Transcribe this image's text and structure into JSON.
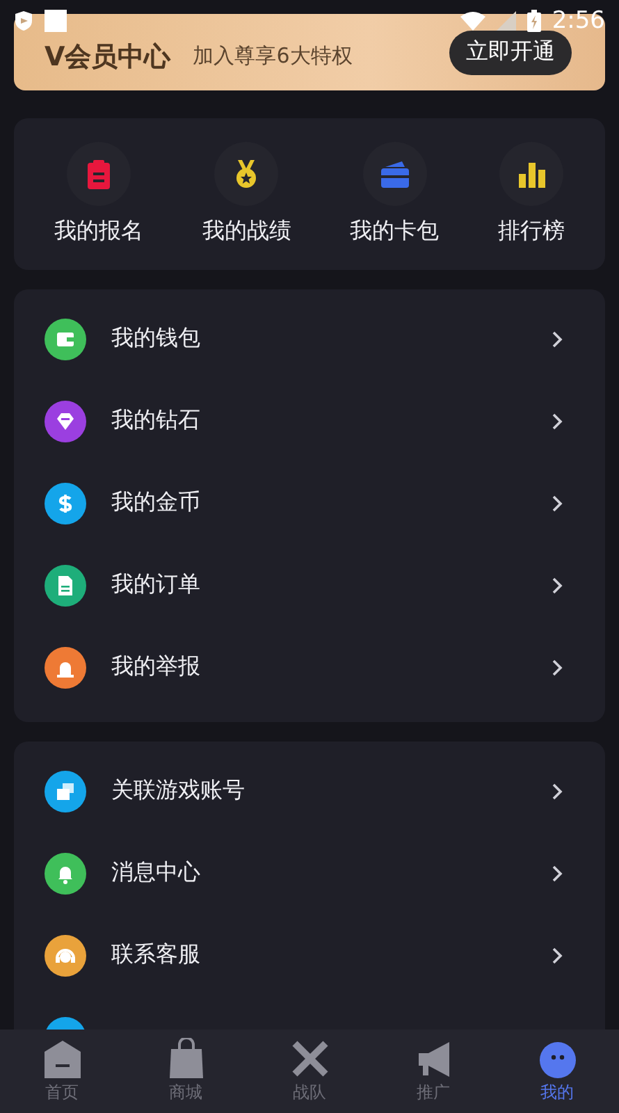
{
  "status_bar": {
    "time": "2:56"
  },
  "vip_banner": {
    "title": "V会员中心",
    "subtitle": "加入尊享6大特权",
    "button": "立即开通"
  },
  "shortcuts": [
    {
      "label": "我的报名"
    },
    {
      "label": "我的战绩"
    },
    {
      "label": "我的卡包"
    },
    {
      "label": "排行榜"
    }
  ],
  "menu_groups": [
    [
      {
        "label": "我的钱包",
        "color": "#3fbf5a"
      },
      {
        "label": "我的钻石",
        "color": "#9b3fe0"
      },
      {
        "label": "我的金币",
        "color": "#14a5ea"
      },
      {
        "label": "我的订单",
        "color": "#1eae7a"
      },
      {
        "label": "我的举报",
        "color": "#ee7a35"
      }
    ],
    [
      {
        "label": "关联游戏账号",
        "color": "#14a5ea"
      },
      {
        "label": "消息中心",
        "color": "#3fbf5a"
      },
      {
        "label": "联系客服",
        "color": "#e9a23b"
      },
      {
        "color": "#14a5ea"
      }
    ]
  ],
  "tab_bar": [
    {
      "label": "首页",
      "selected": false
    },
    {
      "label": "商城",
      "selected": false
    },
    {
      "label": "战队",
      "selected": false
    },
    {
      "label": "推广",
      "selected": false
    },
    {
      "label": "我的",
      "selected": true
    }
  ]
}
